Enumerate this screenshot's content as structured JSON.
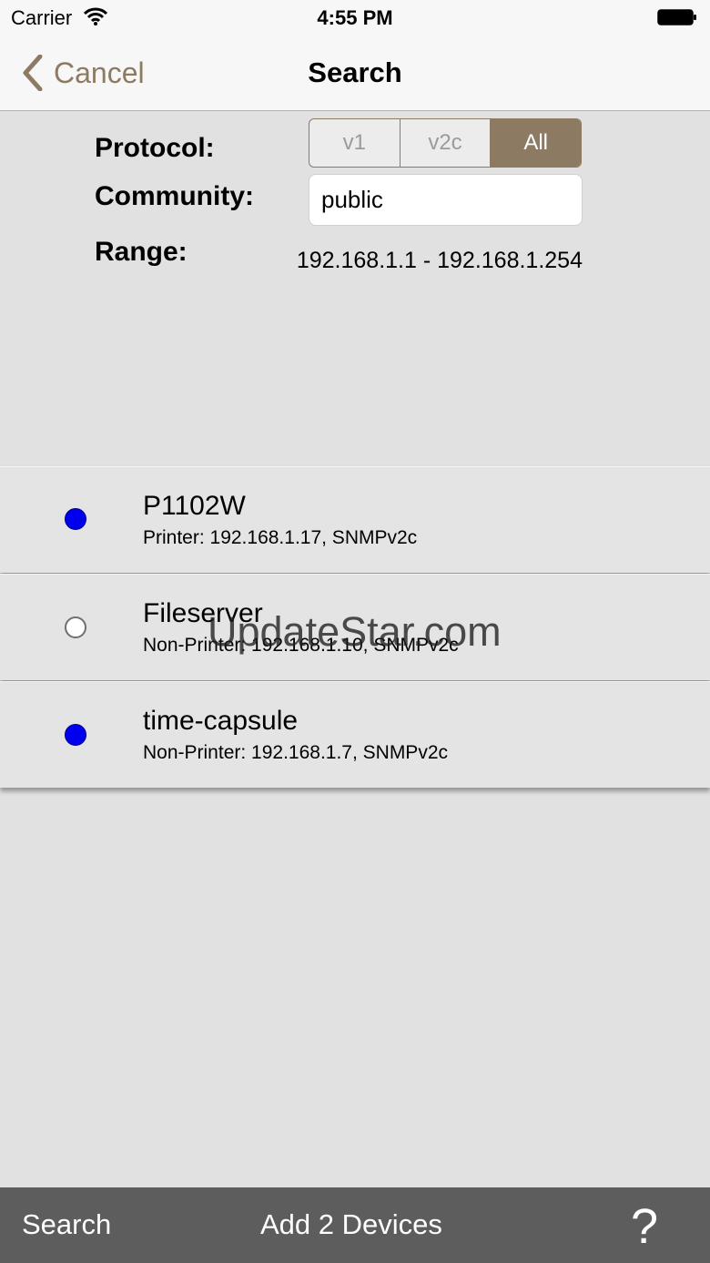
{
  "status_bar": {
    "carrier": "Carrier",
    "time": "4:55 PM"
  },
  "nav": {
    "back_label": "Cancel",
    "title": "Search"
  },
  "form": {
    "protocol_label": "Protocol:",
    "protocol_options": [
      "v1",
      "v2c",
      "All"
    ],
    "protocol_selected": "All",
    "community_label": "Community:",
    "community_value": "public",
    "range_label": "Range:",
    "range_value": "192.168.1.1 - 192.168.1.254"
  },
  "devices": [
    {
      "name": "P1102W",
      "detail": "Printer: 192.168.1.17, SNMPv2c",
      "selected": true
    },
    {
      "name": "Fileserver",
      "detail": "Non-Printer: 192.168.1.10, SNMPv2c",
      "selected": false
    },
    {
      "name": "time-capsule",
      "detail": "Non-Printer: 192.168.1.7, SNMPv2c",
      "selected": true
    }
  ],
  "watermark": "UpdateStar.com",
  "toolbar": {
    "search_label": "Search",
    "add_label": "Add 2 Devices",
    "help_label": "?"
  },
  "colors": {
    "accent": "#8c7b62",
    "radio_on": "#0000ee",
    "toolbar_bg": "#5d5d5d"
  },
  "icons": {
    "back": "chevron-left-icon",
    "wifi": "wifi-icon",
    "battery": "battery-icon"
  }
}
